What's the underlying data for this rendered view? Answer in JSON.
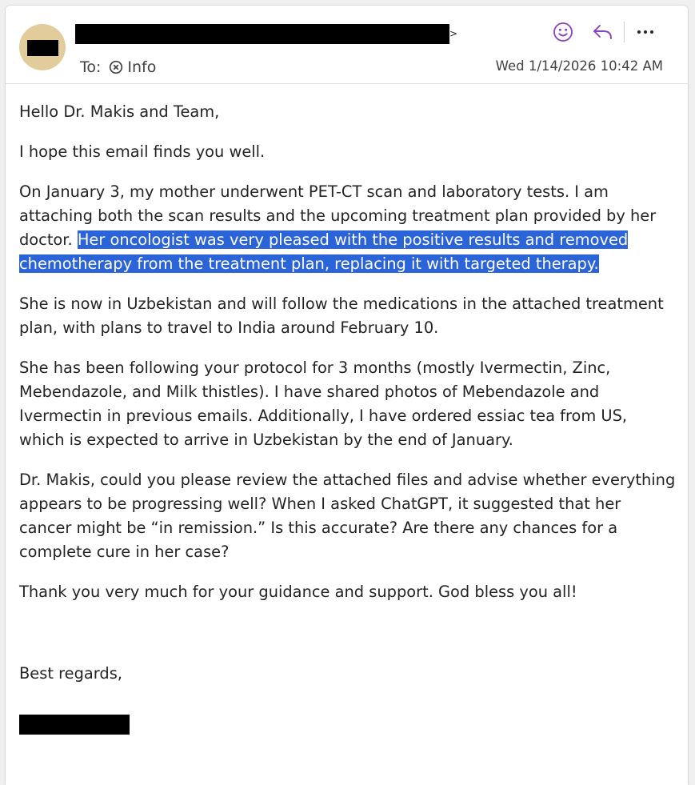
{
  "header": {
    "sender_tail": ">",
    "to_label": "To:",
    "recipient": "Info",
    "date": "Wed 1/14/2026 10:42 AM",
    "icons": [
      "smiley-icon",
      "reply-icon",
      "more-icon",
      "remove-recipient-icon"
    ],
    "accent_color": "#8a3fc4"
  },
  "body": {
    "greeting": "Hello Dr. Makis and Team,",
    "p1": "I hope this email finds you well.",
    "p2_normal": "On January 3, my mother underwent PET-CT scan and laboratory tests. I am attaching both the scan results and the upcoming treatment plan provided by her doctor. ",
    "p2_highlight": "Her oncologist was very pleased with the positive results and removed chemotherapy from the treatment plan, replacing it with targeted therapy.",
    "p3": "She is now in Uzbekistan and will follow the medications in the attached treatment plan, with plans to travel to India around February 10.",
    "p4": "She has been following your protocol for 3 months (mostly Ivermectin, Zinc, Mebendazole, and Milk thistles). I have shared photos of Mebendazole and Ivermectin in previous emails. Additionally, I have ordered essiac tea from US, which is expected to arrive in Uzbekistan by the end of January.",
    "p5": "Dr. Makis, could you please review the attached files and advise whether everything appears to be progressing well? When I asked ChatGPT, it suggested that her cancer might be “in remission.” Is this accurate? Are there any chances for a complete cure in her case?",
    "p6": "Thank you very much for your guidance and support. God bless you all!",
    "closing": "Best regards,",
    "highlight_color": "#2b63d8"
  }
}
